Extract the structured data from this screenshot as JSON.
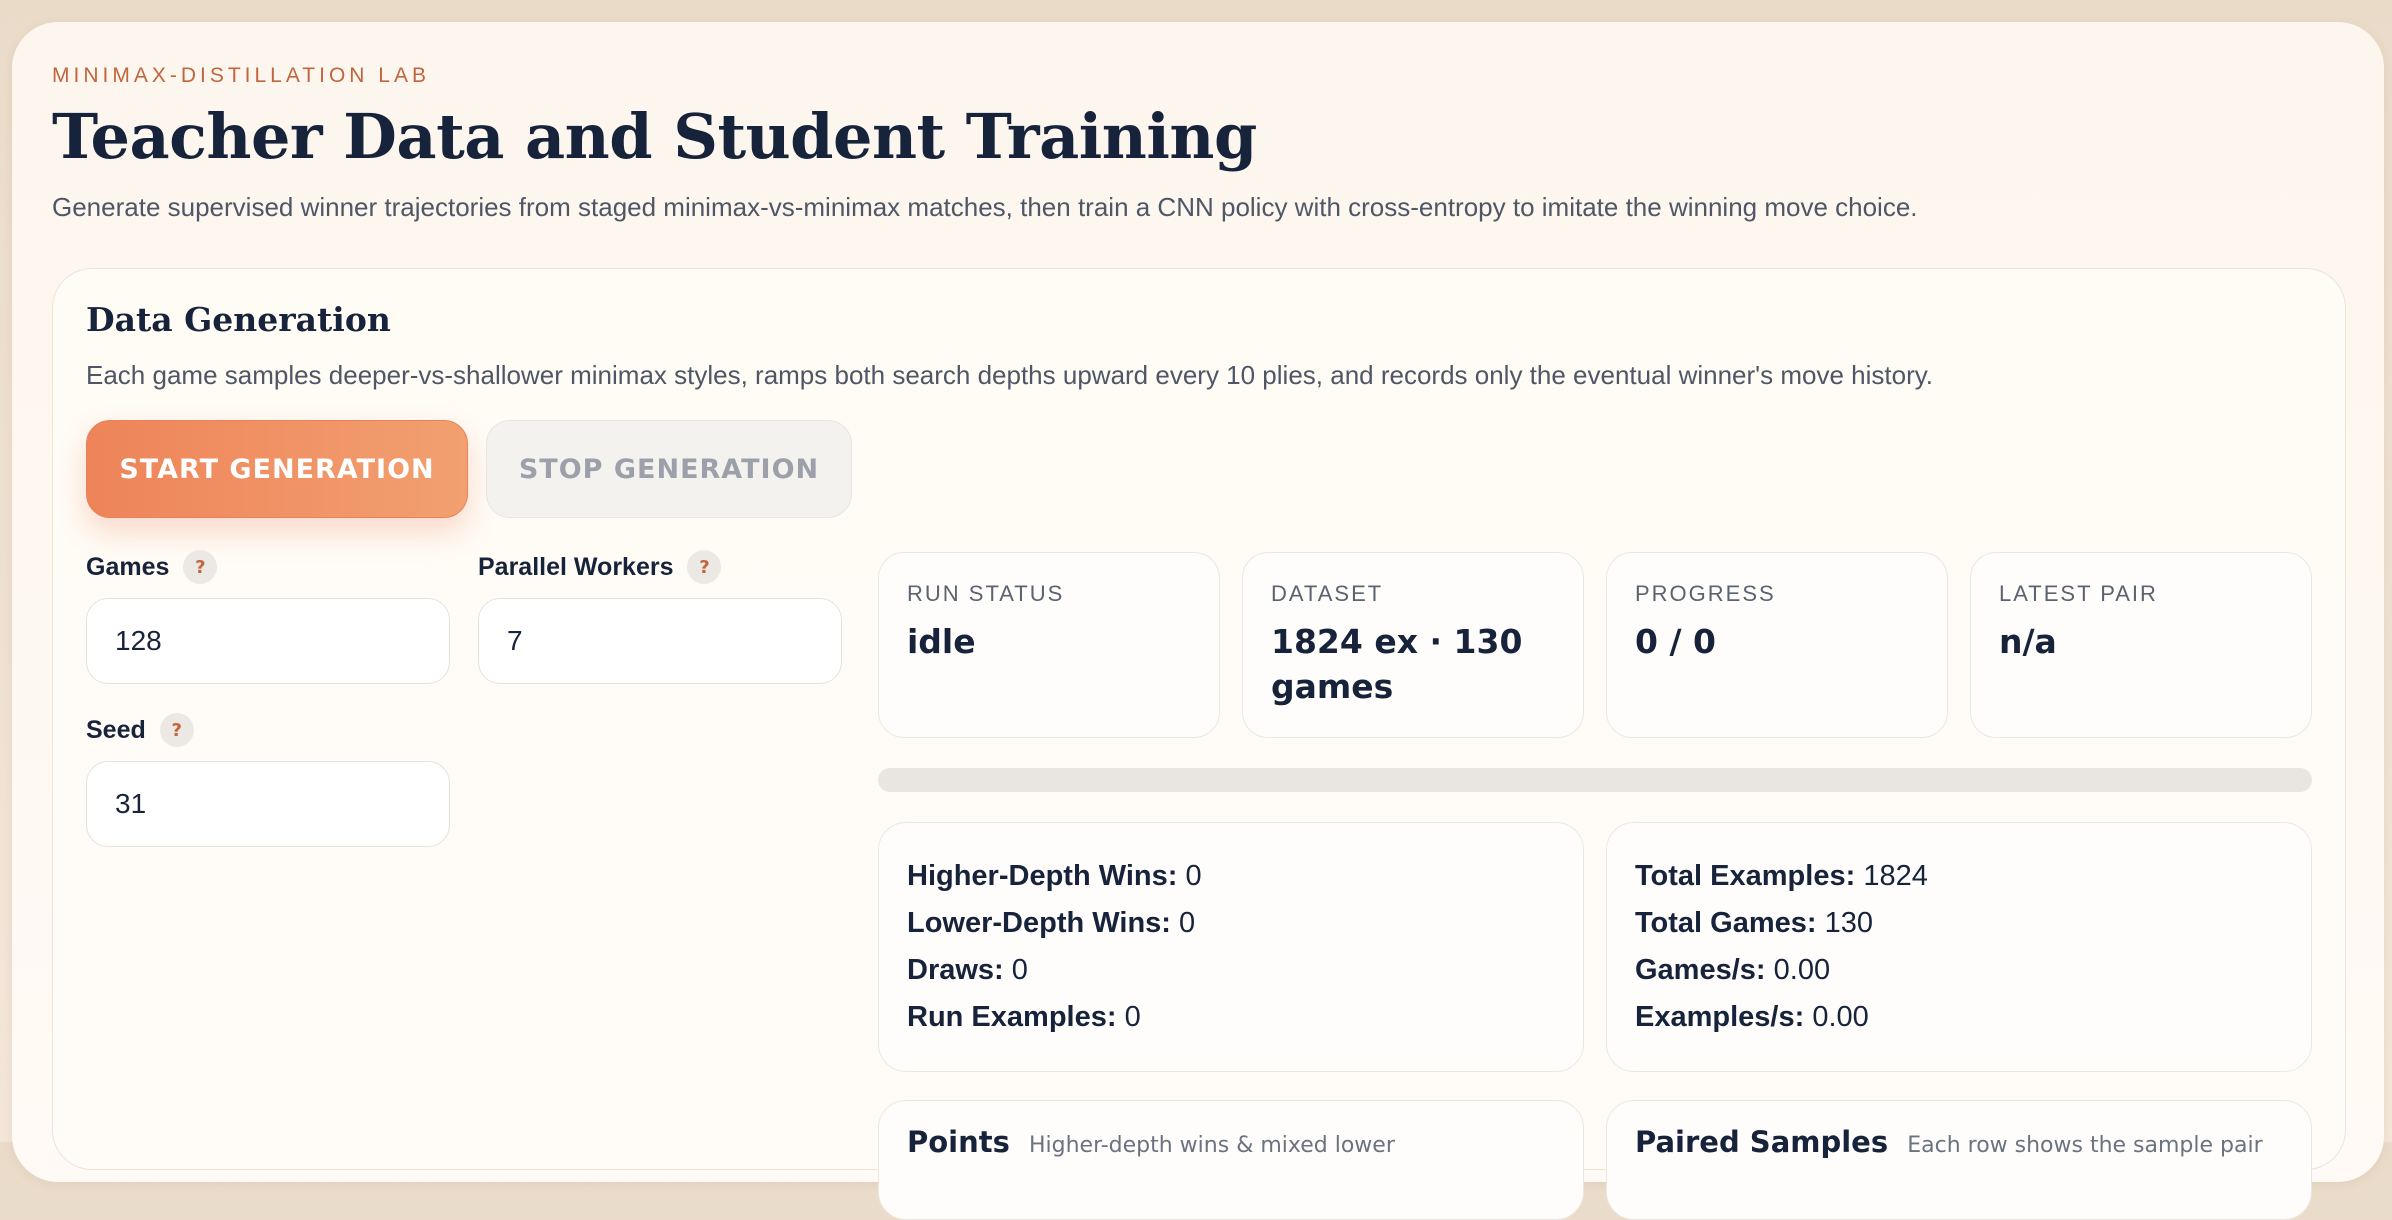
{
  "header": {
    "eyebrow": "MINIMAX-DISTILLATION LAB",
    "title": "Teacher Data and Student Training",
    "subtitle": "Generate supervised winner trajectories from staged minimax-vs-minimax matches, then train a CNN policy with cross-entropy to imitate the winning move choice."
  },
  "generation": {
    "title": "Data Generation",
    "description": "Each game samples deeper-vs-shallower minimax styles, ramps both search depths upward every 10 plies, and records only the eventual winner's move history.",
    "start_label": "START GENERATION",
    "stop_label": "STOP GENERATION",
    "fields": {
      "games": {
        "label": "Games",
        "value": "128"
      },
      "workers": {
        "label": "Parallel Workers",
        "value": "7"
      },
      "seed": {
        "label": "Seed",
        "value": "31"
      }
    },
    "help_glyph": "?",
    "stats": {
      "run_status": {
        "label": "RUN STATUS",
        "value": "idle"
      },
      "dataset": {
        "label": "DATASET",
        "value": "1824 ex · 130 games"
      },
      "progress": {
        "label": "PROGRESS",
        "value": "0 / 0"
      },
      "latest_pair": {
        "label": "LATEST PAIR",
        "value": "n/a"
      }
    },
    "progress_fraction": 0,
    "results": {
      "higher_depth_wins": {
        "label": "Higher-Depth Wins:",
        "value": "0"
      },
      "lower_depth_wins": {
        "label": "Lower-Depth Wins:",
        "value": "0"
      },
      "draws": {
        "label": "Draws:",
        "value": "0"
      },
      "run_examples": {
        "label": "Run Examples:",
        "value": "0"
      }
    },
    "totals": {
      "total_examples": {
        "label": "Total Examples:",
        "value": "1824"
      },
      "total_games": {
        "label": "Total Games:",
        "value": "130"
      },
      "games_per_s": {
        "label": "Games/s:",
        "value": "0.00"
      },
      "examples_per_s": {
        "label": "Examples/s:",
        "value": "0.00"
      }
    },
    "lower_left": {
      "title": "Points",
      "sub": "Higher-depth wins & mixed lower"
    },
    "lower_right": {
      "title": "Paired Samples",
      "sub": "Each row shows the sample pair"
    }
  },
  "colors": {
    "accent": "#ee8459",
    "ink": "#17233a",
    "eyebrow": "#c0653d"
  }
}
